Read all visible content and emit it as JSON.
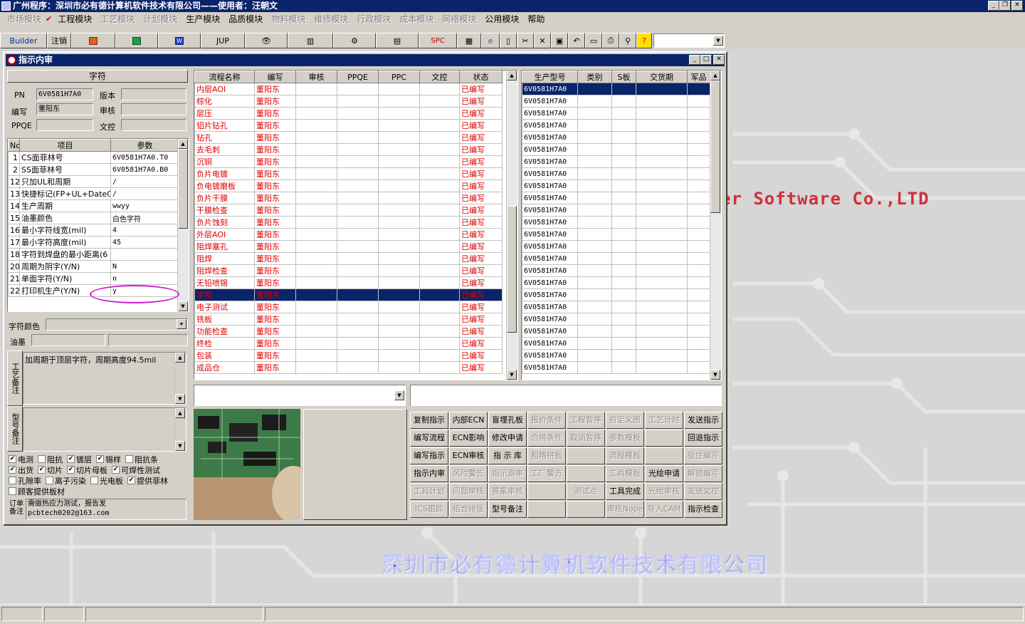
{
  "app": {
    "title": "广州程序：深圳市必有德计算机软件技术有限公司——使用者：汪朝文",
    "win_buttons": [
      "_",
      "❐",
      "✕"
    ]
  },
  "menu": [
    {
      "label": "市场模块",
      "enabled": false
    },
    {
      "label": "工程模块",
      "enabled": true,
      "checked": true
    },
    {
      "label": "工艺模块",
      "enabled": false
    },
    {
      "label": "计划模块",
      "enabled": false
    },
    {
      "label": "生产模块",
      "enabled": true
    },
    {
      "label": "品质模块",
      "enabled": true
    },
    {
      "label": "物料模块",
      "enabled": false
    },
    {
      "label": "维修模块",
      "enabled": false
    },
    {
      "label": "行政模块",
      "enabled": false
    },
    {
      "label": "成本模块",
      "enabled": false
    },
    {
      "label": "网络模块",
      "enabled": false
    },
    {
      "label": "公用模块",
      "enabled": true
    },
    {
      "label": "帮助",
      "enabled": true
    }
  ],
  "toolbar": {
    "builder": "Builder",
    "logout": "注销",
    "jup": "JUP",
    "spc": "SPC"
  },
  "window": {
    "title": "指示内审",
    "buttons": [
      "_",
      "□",
      "✕"
    ]
  },
  "left": {
    "header": "字符",
    "pn_label": "PN",
    "pn_value": "6V0581H7A0",
    "version_label": "版本",
    "version_value": "",
    "author_label": "编写",
    "author_value": "董阳东",
    "review_label": "审核",
    "review_value": "",
    "ppqe_label": "PPQE",
    "ppqe_value": "",
    "doc_label": "文控",
    "doc_value": "",
    "param_headers": [
      "No",
      "项目",
      "参数"
    ],
    "params": [
      [
        "1",
        "CS面菲林号",
        "6V0581H7A0.T0"
      ],
      [
        "2",
        "SS面菲林号",
        "6V0581H7A0.B0"
      ],
      [
        "12",
        "只加UL和周期",
        "/"
      ],
      [
        "13",
        "快捷标记(FP+UL+DateCo",
        "/"
      ],
      [
        "14",
        "生产周期",
        "wwyy"
      ],
      [
        "15",
        "油墨颜色",
        "白色字符"
      ],
      [
        "16",
        "最小字符线宽(mil)",
        "4"
      ],
      [
        "17",
        "最小字符高度(mil)",
        "45"
      ],
      [
        "18",
        "字符到焊盘的最小距离(6",
        ""
      ],
      [
        "20",
        "周期为阴字(Y/N)",
        "N"
      ],
      [
        "21",
        "单面字符(Y/N)",
        "n"
      ],
      [
        "22",
        "打印机生产(Y/N)",
        "y"
      ]
    ],
    "char_color_label": "字符颜色",
    "ink_label": "油墨",
    "process_note_label": "工艺备注",
    "process_note": "加周期于顶层字符，周期高度94.5mil",
    "model_note_label": "型号备注",
    "model_note": "",
    "checks": [
      [
        {
          "label": "电测",
          "checked": true
        },
        {
          "label": "阻抗",
          "checked": false
        },
        {
          "label": "镀层",
          "checked": true
        },
        {
          "label": "锡样",
          "checked": true
        },
        {
          "label": "阻抗条",
          "checked": false
        }
      ],
      [
        {
          "label": "出货",
          "checked": true
        },
        {
          "label": "切片",
          "checked": true
        },
        {
          "label": "切片母板",
          "checked": true
        },
        {
          "label": "可焊性测试",
          "checked": true
        }
      ],
      [
        {
          "label": "孔隙率",
          "checked": false
        },
        {
          "label": "离子污染",
          "checked": false
        },
        {
          "label": "光电板",
          "checked": false
        },
        {
          "label": "提供菲林",
          "checked": true
        }
      ],
      [
        {
          "label": "顾客提供板材",
          "checked": false
        }
      ]
    ],
    "order_note_label": "订单备注",
    "order_note_line1": "需做热应力测试，报告发",
    "order_note_line2": "pcbtech0202@163.com"
  },
  "process": {
    "headers": [
      "流程名称",
      "编写",
      "审核",
      "PPQE",
      "PPC",
      "文控",
      "状态"
    ],
    "rows": [
      [
        "内层AOI",
        "董阳东",
        "已编写"
      ],
      [
        "棕化",
        "董阳东",
        "已编写"
      ],
      [
        "层压",
        "董阳东",
        "已编写"
      ],
      [
        "铝片钻孔",
        "董阳东",
        "已编写"
      ],
      [
        "钻孔",
        "董阳东",
        "已编写"
      ],
      [
        "去毛刺",
        "董阳东",
        "已编写"
      ],
      [
        "沉铜",
        "董阳东",
        "已编写"
      ],
      [
        "负片电镀",
        "董阳东",
        "已编写"
      ],
      [
        "负电镀磨板",
        "董阳东",
        "已编写"
      ],
      [
        "负片干膜",
        "董阳东",
        "已编写"
      ],
      [
        "干膜检查",
        "董阳东",
        "已编写"
      ],
      [
        "负片蚀刻",
        "董阳东",
        "已编写"
      ],
      [
        "外层AOI",
        "董阳东",
        "已编写"
      ],
      [
        "阻焊塞孔",
        "董阳东",
        "已编写"
      ],
      [
        "阻焊",
        "董阳东",
        "已编写"
      ],
      [
        "阻焊检查",
        "董阳东",
        "已编写"
      ],
      [
        "无铅喷锡",
        "董阳东",
        "已编写"
      ],
      [
        "字符",
        "董阳东",
        "已编写"
      ],
      [
        "电子测试",
        "董阳东",
        "已编写"
      ],
      [
        "铣板",
        "董阳东",
        "已编写"
      ],
      [
        "功能检查",
        "董阳东",
        "已编写"
      ],
      [
        "终检",
        "董阳东",
        "已编写"
      ],
      [
        "包装",
        "董阳东",
        "已编写"
      ],
      [
        "成品仓",
        "董阳东",
        "已编写"
      ]
    ],
    "selected_index": 17
  },
  "models": {
    "headers": [
      "生产型号",
      "类别",
      "S板",
      "交货期",
      "军品"
    ],
    "rows": [
      "6V0581H7A0",
      "6V0581H7A0",
      "6V0581H7A0",
      "6V0581H7A0",
      "6V0581H7A0",
      "6V0581H7A0",
      "6V0581H7A0",
      "6V0581H7A0",
      "6V0581H7A0",
      "6V0581H7A0",
      "6V0581H7A0",
      "6V0581H7A0",
      "6V0581H7A0",
      "6V0581H7A0",
      "6V0581H7A0",
      "6V0581H7A0",
      "6V0581H7A0",
      "6V0581H7A0",
      "6V0581H7A0",
      "6V0581H7A0",
      "6V0581H7A0",
      "6V0581H7A0",
      "6V0581H7A0",
      "6V0581H7A0"
    ],
    "selected_index": 0
  },
  "commands": [
    [
      {
        "label": "复制指示",
        "enabled": true
      },
      {
        "label": "内部ECN",
        "enabled": true
      },
      {
        "label": "盲埋孔板",
        "enabled": true
      },
      {
        "label": "报价条件",
        "enabled": false
      },
      {
        "label": "工程暂停",
        "enabled": false
      },
      {
        "label": "自定义图",
        "enabled": false
      },
      {
        "label": "工艺计时",
        "enabled": false
      },
      {
        "label": "发送指示",
        "enabled": true
      }
    ],
    [
      {
        "label": "编写流程",
        "enabled": true
      },
      {
        "label": "ECN影响",
        "enabled": true
      },
      {
        "label": "修改申请",
        "enabled": true
      },
      {
        "label": "合拼条件",
        "enabled": false
      },
      {
        "label": "取消暂停",
        "enabled": false
      },
      {
        "label": "参数模板",
        "enabled": false
      },
      {
        "label": "",
        "enabled": false
      },
      {
        "label": "回退指示",
        "enabled": true
      }
    ],
    [
      {
        "label": "编写指示",
        "enabled": true
      },
      {
        "label": "ECN审核",
        "enabled": true
      },
      {
        "label": "指 示 库",
        "enabled": true
      },
      {
        "label": "粗略拼板",
        "enabled": false
      },
      {
        "label": "",
        "enabled": false
      },
      {
        "label": "流程模板",
        "enabled": false
      },
      {
        "label": "",
        "enabled": false
      },
      {
        "label": "锁住编写",
        "enabled": false
      }
    ],
    [
      {
        "label": "指示内审",
        "enabled": true
      },
      {
        "label": "风险警告",
        "enabled": false
      },
      {
        "label": "指示退审",
        "enabled": false
      },
      {
        "label": "工厂警告",
        "enabled": false
      },
      {
        "label": "",
        "enabled": false
      },
      {
        "label": "工具模板",
        "enabled": false
      },
      {
        "label": "光绘申请",
        "enabled": true
      },
      {
        "label": "解锁编写",
        "enabled": false
      }
    ],
    [
      {
        "label": "工具计划",
        "enabled": false
      },
      {
        "label": "问题审核",
        "enabled": false
      },
      {
        "label": "答案审核",
        "enabled": false
      },
      {
        "label": "",
        "enabled": false
      },
      {
        "label": "测试点",
        "enabled": false
      },
      {
        "label": "工具完成",
        "enabled": true
      },
      {
        "label": "光绘审核",
        "enabled": false
      },
      {
        "label": "发送文控",
        "enabled": false
      }
    ],
    [
      {
        "label": "ICS跟踪",
        "enabled": false
      },
      {
        "label": "组合排版",
        "enabled": false
      },
      {
        "label": "型号备注",
        "enabled": true
      },
      {
        "label": "",
        "enabled": false
      },
      {
        "label": "",
        "enabled": false
      },
      {
        "label": "审核Nope",
        "enabled": false
      },
      {
        "label": "导入CAM",
        "enabled": false
      },
      {
        "label": "指示检查",
        "enabled": true
      }
    ]
  ],
  "background": {
    "company_en": "er Software Co.,LTD",
    "company_cn": "深圳市必有德计算机软件技术有限公司"
  }
}
